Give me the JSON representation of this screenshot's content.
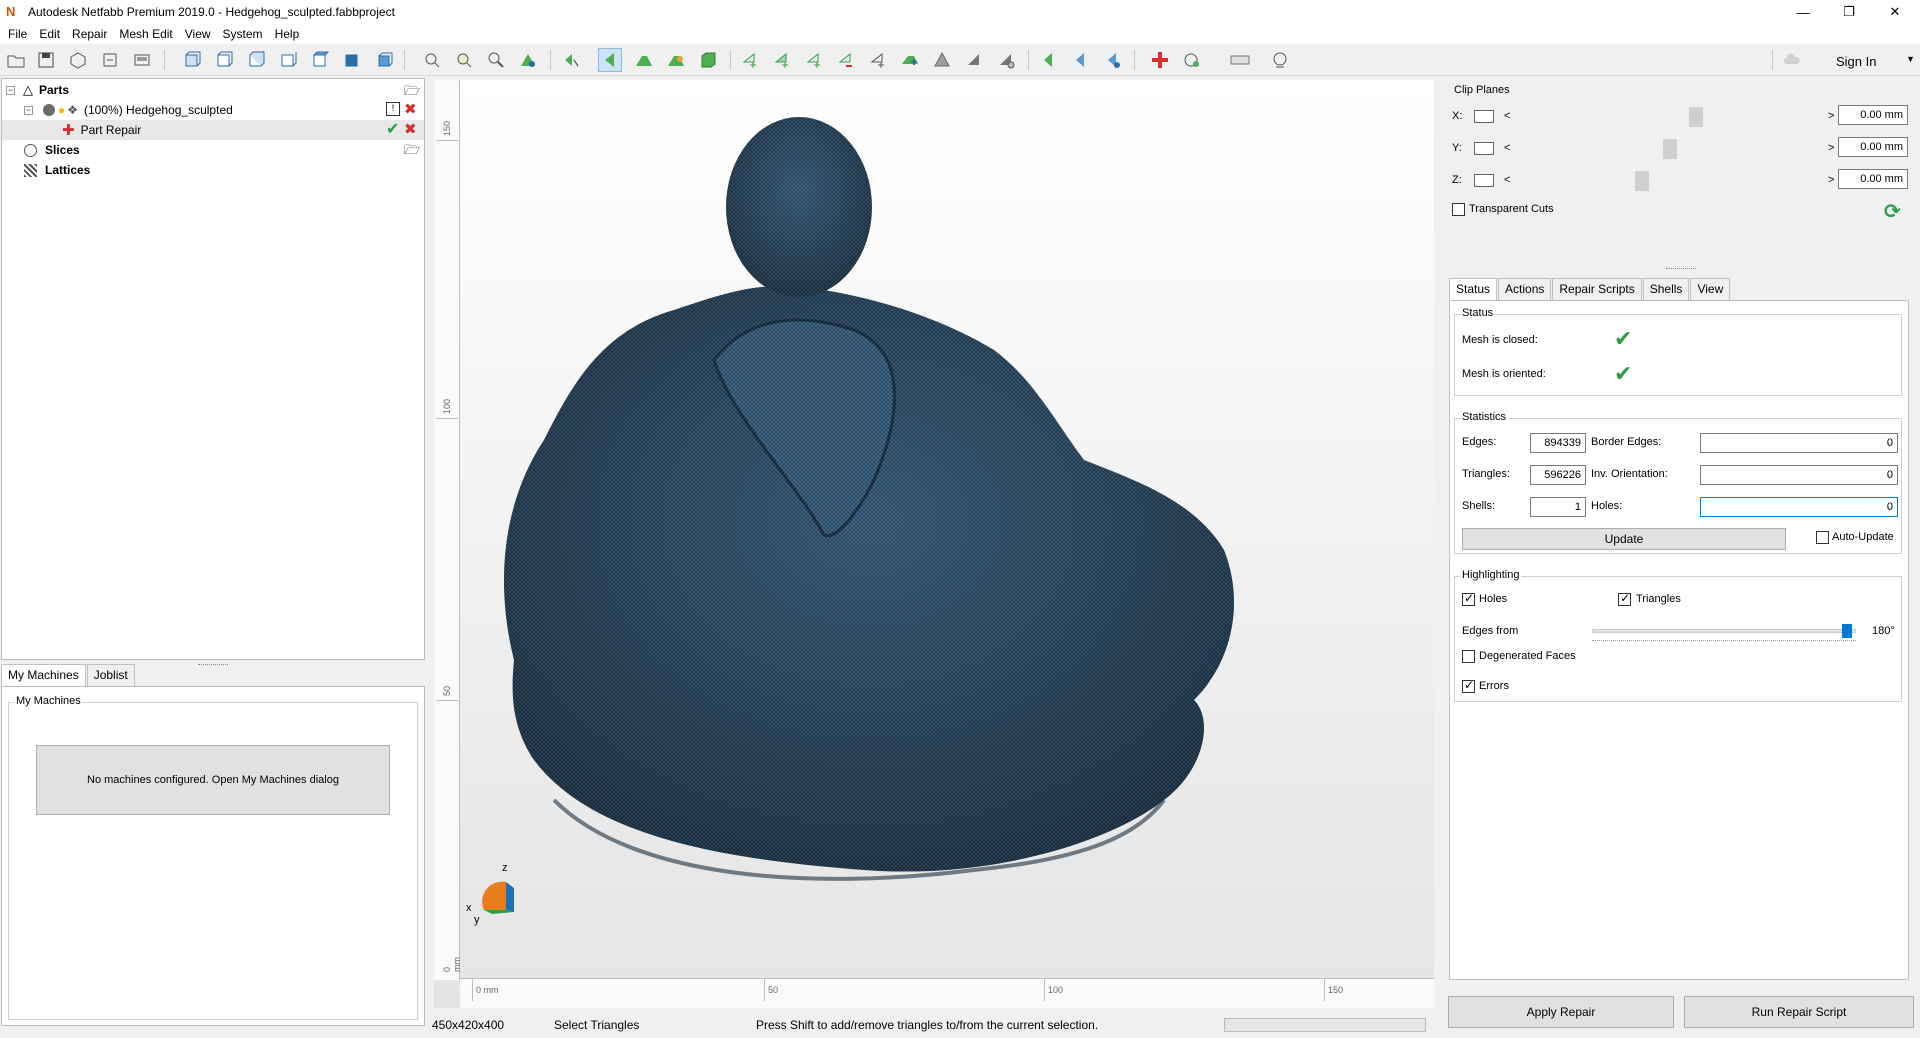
{
  "window": {
    "title": "Autodesk Netfabb Premium 2019.0 - Hedgehog_sculpted.fabbproject",
    "app_icon": "N"
  },
  "menu": [
    "File",
    "Edit",
    "Repair",
    "Mesh Edit",
    "View",
    "System",
    "Help"
  ],
  "toolbar": {
    "sign_in": "Sign In"
  },
  "tree": {
    "parts": "Parts",
    "part_name": "(100%) Hedgehog_sculpted",
    "part_repair": "Part Repair",
    "slices": "Slices",
    "lattices": "Lattices"
  },
  "bottom_tabs": [
    "My Machines",
    "Joblist"
  ],
  "machines": {
    "group_label": "My Machines",
    "empty_button": "No machines configured. Open My Machines dialog"
  },
  "viewport": {
    "ruler_v": [
      "150",
      "100",
      "50",
      "0 mm"
    ],
    "ruler_h": [
      "0 mm",
      "50",
      "100",
      "150"
    ],
    "axes": {
      "x": "x",
      "y": "y",
      "z": "z"
    }
  },
  "statusbar": {
    "dimensions": "450x420x400",
    "mode": "Select Triangles",
    "hint": "Press Shift to add/remove triangles to/from the current selection."
  },
  "clip_planes": {
    "title": "Clip Planes",
    "rows": [
      {
        "axis": "X:",
        "value": "0.00 mm",
        "slider": 0.42
      },
      {
        "axis": "Y:",
        "value": "0.00 mm",
        "slider": 0.4
      },
      {
        "axis": "Z:",
        "value": "0.00 mm",
        "slider": 0.38
      }
    ],
    "transparent_cuts": "Transparent Cuts"
  },
  "right_tabs": [
    "Status",
    "Actions",
    "Repair Scripts",
    "Shells",
    "View"
  ],
  "status": {
    "group": "Status",
    "mesh_closed": "Mesh is closed:",
    "mesh_oriented": "Mesh is oriented:"
  },
  "statistics": {
    "group": "Statistics",
    "edges_label": "Edges:",
    "edges": "894339",
    "border_edges_label": "Border Edges:",
    "border_edges": "0",
    "triangles_label": "Triangles:",
    "triangles": "596226",
    "inv_orientation_label": "Inv. Orientation:",
    "inv_orientation": "0",
    "shells_label": "Shells:",
    "shells": "1",
    "holes_label": "Holes:",
    "holes": "0",
    "update_button": "Update",
    "auto_update": "Auto-Update"
  },
  "highlighting": {
    "group": "Highlighting",
    "holes": "Holes",
    "triangles": "Triangles",
    "edges_from": "Edges from",
    "edges_value": "180°",
    "degenerated_faces": "Degenerated Faces",
    "errors": "Errors"
  },
  "buttons": {
    "apply_repair": "Apply Repair",
    "run_repair_script": "Run Repair Script"
  },
  "colors": {
    "mesh": "#2b4a63",
    "accent": "#2e9e46",
    "delete": "#d32f2f"
  }
}
